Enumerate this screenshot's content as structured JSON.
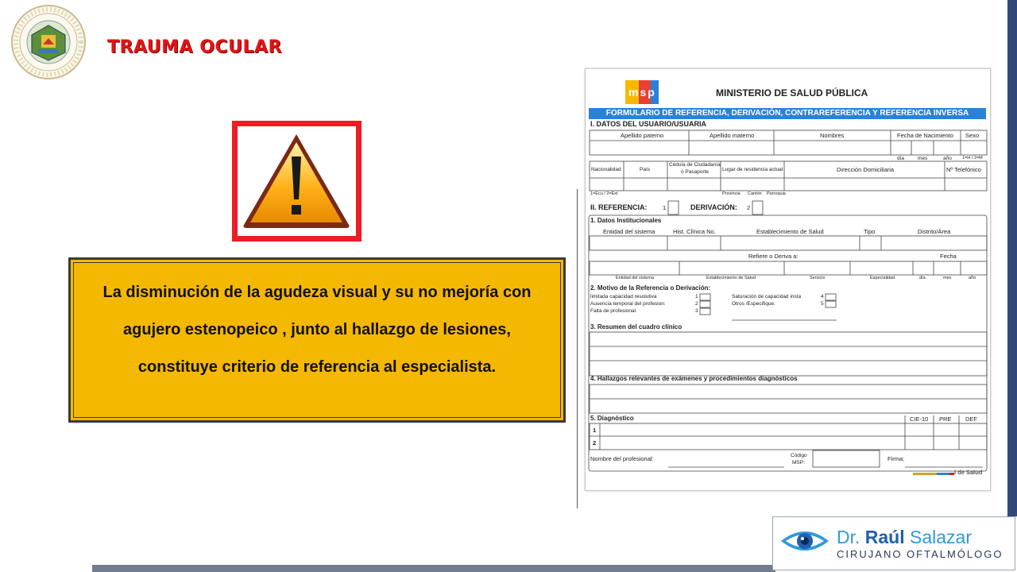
{
  "slide": {
    "title": "TRAUMA OCULAR",
    "callout_text": "La disminución de la agudeza visual y su no mejoría con agujero estenopeico , junto al hallazgo de lesiones, constituye criterio de referencia al especialista."
  },
  "colors": {
    "title": "#e31414",
    "callout_bg": "#f5b800",
    "warning_border": "#ee1c24",
    "form_banner": "#2a82d8",
    "right_stripe": "#2f4a78"
  },
  "icons": {
    "seal": "university-seal-icon",
    "warning": "warning-triangle-icon",
    "eye": "eye-icon"
  },
  "form": {
    "logo_letters": "msp",
    "ministry": "MINISTERIO DE SALUD PÚBLICA",
    "banner": "FORMULARIO DE REFERENCIA, DERIVACIÓN, CONTRAREFERENCIA Y REFERENCIA INVERSA",
    "s1_title": "I. DATOS DEL USUARIO/USUARIA",
    "h_apellido_paterno": "Apellido paterno",
    "h_apellido_materno": "Apellido materno",
    "h_nombres": "Nombres",
    "h_fecha_nac": "Fecha de Nacimiento",
    "h_sexo": "Sexo",
    "h_dia": "día",
    "h_mes": "mes",
    "h_ano": "año",
    "h_sexo_code": "1=H / 2=M",
    "h_nacionalidad": "Nacionalidad",
    "h_pais": "País",
    "h_cedula": "Cédula de Ciudadanía",
    "h_pasaporte": "ó Pasaporte",
    "h_lugar": "Lugar de residencia actual",
    "h_direccion": "Dirección Domiciliaria",
    "h_telefono": "Nº Telefónico",
    "h_nac_code": "1=Ecu / 2=Ext",
    "h_provincia": "Provincia",
    "h_canton": "Cantón",
    "h_parroquia": "Parroquia",
    "s2_referencia": "II. REFERENCIA:",
    "ref_num": "1",
    "s2_derivacion": "DERIVACIÓN:",
    "der_num": "2",
    "s21": "1. Datos Institucionales",
    "h_entidad": "Entidad del sistema",
    "h_hist": "Hist. Clínica No.",
    "h_estab": "Establecimiento de Salud",
    "h_tipo": "Tipo",
    "h_distrito": "Distrito/Área",
    "h_refiere": "Refiere o Deriva a:",
    "h_fecha": "Fecha",
    "h_entidad2": "Entidad del sistema",
    "h_estab2": "Establecimiento de Salud",
    "h_servicio": "Servicio",
    "h_especialidad": "Especialidad",
    "s22": "2. Motivo de la Referencia o Derivación:",
    "m1": "limitada capacidad resolutiva",
    "m2": "Ausencia temporal del profesion:",
    "m3": "Falta de profesional",
    "m4": "Saturación de capacidad insta",
    "m5": "Otros /Especifique:",
    "n1": "1",
    "n2": "2",
    "n3": "3",
    "n4": "4",
    "n5": "5",
    "s23": "3. Resumen del cuadro clínico",
    "s24": "4. Hallazgos relevantes de exámenes y procedimientos diagnósticos",
    "s25": "5. Diagnóstico",
    "h_cie": "CIE-10",
    "h_pre": "PRE",
    "h_def": "DEF",
    "d1": "1",
    "d2": "2",
    "h_profesional": "Nombre del profesional:",
    "h_codigo": "Código",
    "h_msp": "MSP:",
    "h_firma": "Firma:",
    "footer_mark": "l de Salud"
  },
  "logo": {
    "name_prefix": "Dr.",
    "name_bold": "Raúl",
    "name_last": "Salazar",
    "subtitle": "CIRUJANO OFTALMÓLOGO"
  }
}
